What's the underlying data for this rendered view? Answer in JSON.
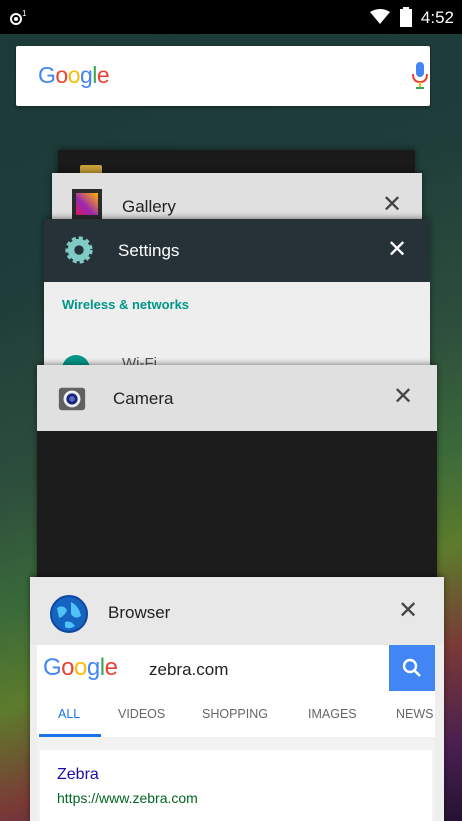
{
  "status_bar": {
    "time": "4:52"
  },
  "search_bar": {
    "logo": [
      "G",
      "o",
      "o",
      "g",
      "l",
      "e"
    ]
  },
  "recents": {
    "hidden_card": {},
    "gallery": {
      "title": "Gallery",
      "close": "✕"
    },
    "settings": {
      "title": "Settings",
      "close": "✕",
      "section": "Wireless & networks",
      "first_item": "Wi-Fi"
    },
    "camera": {
      "title": "Camera",
      "close": "✕"
    },
    "browser": {
      "title": "Browser",
      "close": "✕",
      "query": "zebra.com",
      "tabs": [
        "ALL",
        "VIDEOS",
        "SHOPPING",
        "IMAGES",
        "NEWS"
      ],
      "result": {
        "title": "Zebra",
        "url": "https://www.zebra.com"
      }
    }
  }
}
